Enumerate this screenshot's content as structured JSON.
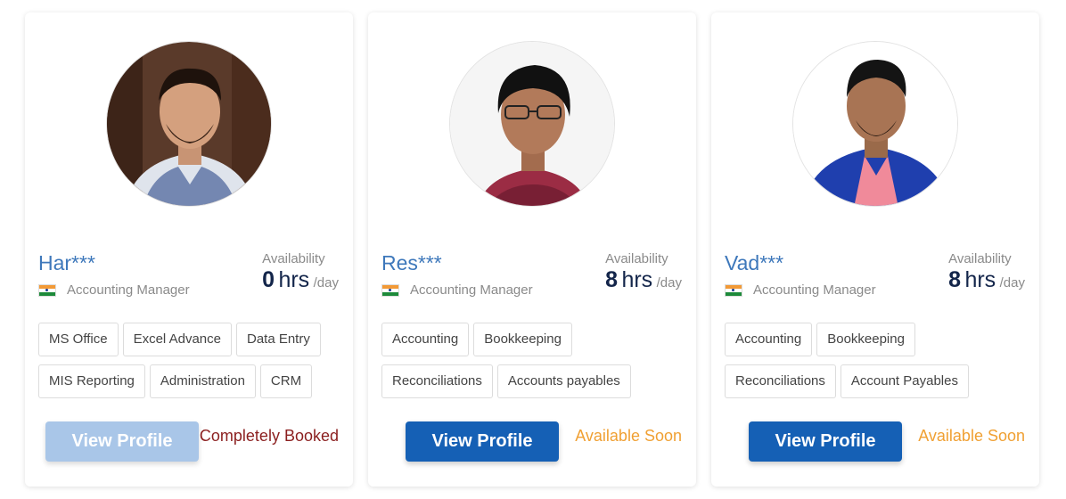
{
  "colors": {
    "name": "#3e78bb",
    "hours": "#13254a",
    "button_active": "#1560b5",
    "button_disabled": "#a9c6e8",
    "status_booked": "#8b1f1f",
    "status_soon": "#f0a033"
  },
  "cards": [
    {
      "name": "Har***",
      "role": "Accounting Manager",
      "flag_icon": "india-flag-icon",
      "availability_label": "Availability",
      "hours": "0",
      "hours_unit": "hrs",
      "per_day": "/day",
      "skills": [
        "MS Office",
        "Excel Advance",
        "Data Entry",
        "MIS Reporting",
        "Administration",
        "CRM"
      ],
      "button_label": "View Profile",
      "button_state": "disabled",
      "status": "Completely Booked",
      "status_color": "#8b1f1f"
    },
    {
      "name": "Res***",
      "role": "Accounting Manager",
      "flag_icon": "india-flag-icon",
      "availability_label": "Availability",
      "hours": "8",
      "hours_unit": "hrs",
      "per_day": "/day",
      "skills": [
        "Accounting",
        "Bookkeeping",
        "Reconciliations",
        "Accounts payables"
      ],
      "button_label": "View Profile",
      "button_state": "active",
      "status": "Available Soon",
      "status_color": "#f0a033"
    },
    {
      "name": "Vad***",
      "role": "Accounting Manager",
      "flag_icon": "india-flag-icon",
      "availability_label": "Availability",
      "hours": "8",
      "hours_unit": "hrs",
      "per_day": "/day",
      "skills": [
        "Accounting",
        "Bookkeeping",
        "Reconciliations",
        "Account Payables"
      ],
      "button_label": "View Profile",
      "button_state": "active",
      "status": "Available Soon",
      "status_color": "#f0a033"
    }
  ]
}
